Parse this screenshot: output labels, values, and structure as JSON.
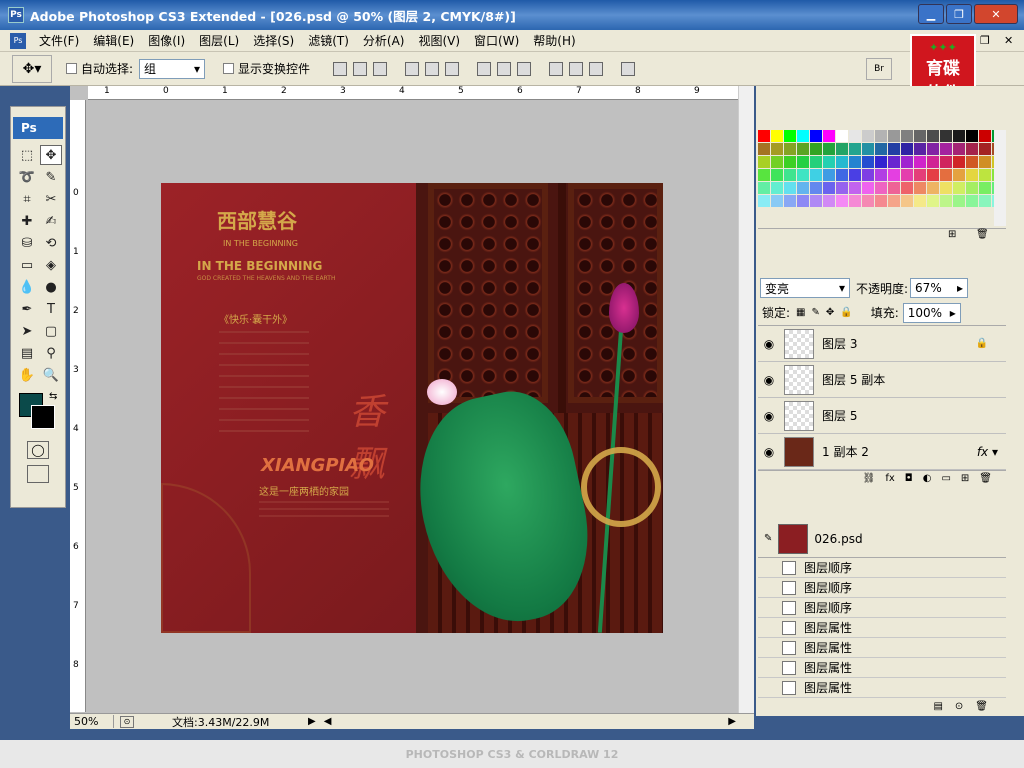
{
  "window": {
    "title": "Adobe Photoshop CS3 Extended - [026.psd @ 50% (图层 2, CMYK/8#)]",
    "app_icon": "Ps"
  },
  "menu": [
    "文件(F)",
    "编辑(E)",
    "图像(I)",
    "图层(L)",
    "选择(S)",
    "滤镜(T)",
    "分析(A)",
    "视图(V)",
    "窗口(W)",
    "帮助(H)"
  ],
  "options": {
    "auto_select_label": "自动选择:",
    "auto_select_value": "组",
    "show_transform_label": "显示变换控件"
  },
  "brand": {
    "line1": "育碟",
    "line2": "软件"
  },
  "toolbox": {
    "logo": "Ps"
  },
  "ruler": {
    "top": [
      "1",
      "0",
      "1",
      "2",
      "3",
      "4",
      "5",
      "6",
      "7",
      "8",
      "9"
    ],
    "left": [
      "0",
      "1",
      "2",
      "3",
      "4",
      "5",
      "6",
      "7",
      "8"
    ]
  },
  "document": {
    "logo_text": "西部慧谷",
    "heading1": "IN THE BEGINNING",
    "heading2": "IN THE BEGINNING",
    "sub1": "GOD CREATED THE HEAVENS AND THE EARTH",
    "section": "《快乐·囊干外》",
    "xiang": "XIANGPIAO",
    "tagline": "这是一座两栖的家园"
  },
  "status": {
    "zoom": "50%",
    "doc": "文档:3.43M/22.9M"
  },
  "layers": {
    "blend_mode": "变亮",
    "opacity_label": "不透明度:",
    "opacity_value": "67%",
    "lock_label": "锁定:",
    "fill_label": "填充:",
    "fill_value": "100%",
    "items": [
      {
        "name": "图层 3"
      },
      {
        "name": "图层 5 副本"
      },
      {
        "name": "图层 5"
      },
      {
        "name": "1 副本 2"
      }
    ]
  },
  "history": {
    "snapshot": "026.psd",
    "items": [
      "图层顺序",
      "图层顺序",
      "图层顺序",
      "图层属性",
      "图层属性",
      "图层属性",
      "图层属性"
    ]
  },
  "footer": {
    "text": "PHOTOSHOP CS3 & CORLDRAW 12"
  },
  "colors": {
    "title_bar": "#2c66b0",
    "doc_red": "#8b1e22",
    "fg_color": "#0b4a4a",
    "bg_color": "#000000"
  }
}
